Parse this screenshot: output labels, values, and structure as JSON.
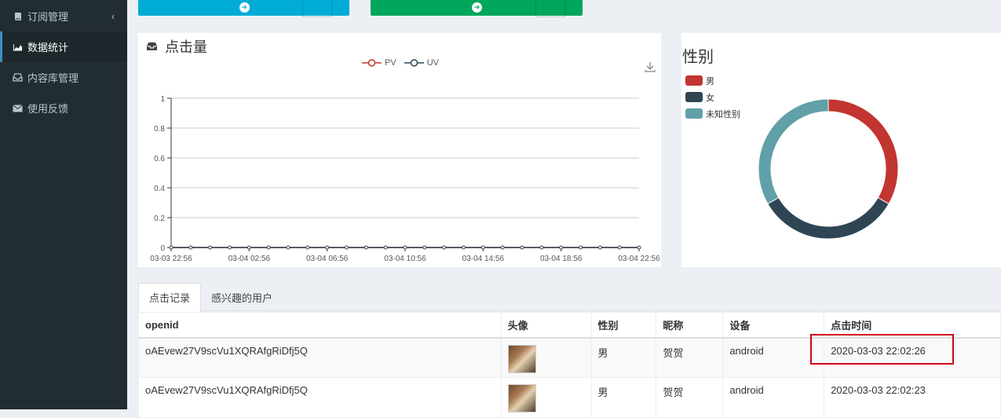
{
  "sidebar": {
    "items": [
      {
        "label": "订阅管理",
        "icon": "book-icon"
      },
      {
        "label": "数据统计",
        "icon": "area-chart-icon"
      },
      {
        "label": "内容库管理",
        "icon": "inbox-icon"
      },
      {
        "label": "使用反馈",
        "icon": "envelope-icon"
      }
    ]
  },
  "top_buttons": {
    "left_color": "#00acd6",
    "right_color": "#00a65a"
  },
  "click_panel": {
    "title": "点击量"
  },
  "gender_panel": {
    "title": "性别",
    "legend": [
      {
        "label": "男",
        "color": "#c23531"
      },
      {
        "label": "女",
        "color": "#2f4554"
      },
      {
        "label": "未知性别",
        "color": "#61a0a8"
      }
    ]
  },
  "chart_data": [
    {
      "type": "line",
      "x": [
        "03-03 22:56",
        "03-04 02:56",
        "03-04 06:56",
        "03-04 10:56",
        "03-04 14:56",
        "03-04 18:56",
        "03-04 22:56"
      ],
      "series": [
        {
          "name": "PV",
          "values": [
            0,
            0,
            0,
            0,
            0,
            0,
            0
          ],
          "color": "#c23531"
        },
        {
          "name": "UV",
          "values": [
            0,
            0,
            0,
            0,
            0,
            0,
            0
          ],
          "color": "#2f4554"
        }
      ],
      "y_ticks": [
        "0",
        "0.2",
        "0.4",
        "0.6",
        "0.8",
        "1"
      ],
      "ylim": [
        0,
        1
      ],
      "grid": true,
      "legend": "top-center"
    },
    {
      "type": "pie",
      "categories": [
        "男",
        "女",
        "未知性别"
      ],
      "values": [
        1,
        1,
        1
      ],
      "colors": [
        "#c23531",
        "#2f4554",
        "#61a0a8"
      ],
      "legend": "top-left"
    }
  ],
  "tabs": [
    {
      "label": "点击记录"
    },
    {
      "label": "感兴趣的用户"
    }
  ],
  "table": {
    "headers": [
      "openid",
      "头像",
      "性别",
      "昵称",
      "设备",
      "点击时间"
    ],
    "rows": [
      {
        "openid": "oAEvew27V9scVu1XQRAfgRiDfj5Q",
        "gender": "男",
        "nickname": "贺贺",
        "device": "android",
        "time": "2020-03-03 22:02:26"
      },
      {
        "openid": "oAEvew27V9scVu1XQRAfgRiDfj5Q",
        "gender": "男",
        "nickname": "贺贺",
        "device": "android",
        "time": "2020-03-03 22:02:23"
      }
    ]
  }
}
